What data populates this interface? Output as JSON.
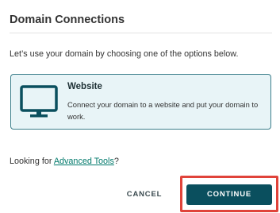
{
  "dialog": {
    "title": "Domain Connections",
    "intro": "Let’s use your domain by choosing one of the options below."
  },
  "option": {
    "icon": "monitor-icon",
    "title": "Website",
    "description": "Connect your domain to a website and put your domain to work."
  },
  "footer": {
    "looking_prefix": "Looking for ",
    "advanced_link": "Advanced Tools",
    "looking_suffix": "?"
  },
  "buttons": {
    "cancel_label": "CANCEL",
    "continue_label": "CONTINUE"
  },
  "colors": {
    "accent": "#0a4f5e",
    "card_bg": "#e8f4f7",
    "card_border": "#3d7f8c",
    "link": "#00796b",
    "highlight": "#e0433a"
  }
}
